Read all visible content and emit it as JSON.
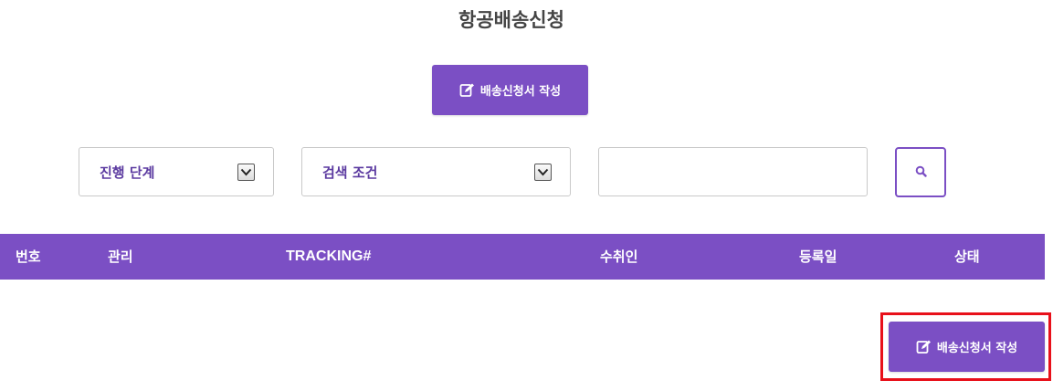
{
  "page": {
    "title": "항공배송신청"
  },
  "actions": {
    "create_label_top": "배송신청서 작성",
    "create_label_bottom": "배송신청서 작성",
    "icon": "edit-icon"
  },
  "filters": {
    "stage_select": {
      "value": "진행 단계"
    },
    "condition_select": {
      "value": "검색 조건"
    },
    "search": {
      "value": "",
      "placeholder": ""
    },
    "search_icon": "search-icon"
  },
  "table": {
    "columns": [
      "번호",
      "관리",
      "TRACKING#",
      "수취인",
      "등록일",
      "상태"
    ],
    "rows": []
  },
  "colors": {
    "accent": "#7b4fc4",
    "highlight": "#e8101a"
  }
}
